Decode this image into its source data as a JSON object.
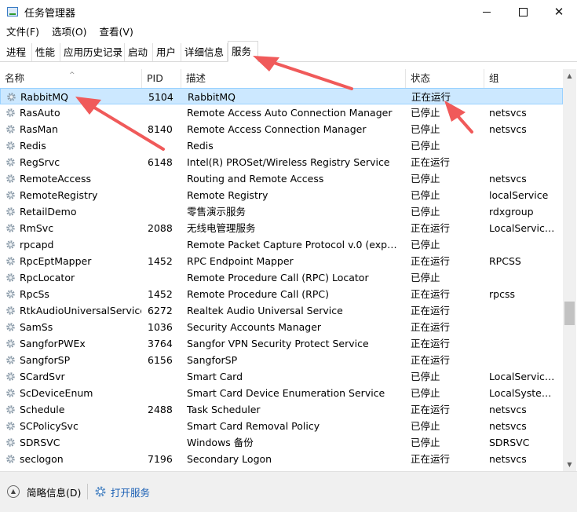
{
  "window": {
    "title": "任务管理器",
    "icon": "task-manager-icon",
    "controls": {
      "minimize": "minimize-icon",
      "maximize": "maximize-icon",
      "close": "✕"
    }
  },
  "menu": {
    "items": [
      "文件(F)",
      "选项(O)",
      "查看(V)"
    ]
  },
  "tabs": [
    "进程",
    "性能",
    "应用历史记录",
    "启动",
    "用户",
    "详细信息",
    "服务"
  ],
  "active_tab": "服务",
  "table": {
    "columns": {
      "name": "名称",
      "pid": "PID",
      "desc": "描述",
      "status": "状态",
      "group": "组"
    },
    "sort_indicator": "^",
    "rows": [
      {
        "name": "RabbitMQ",
        "pid": "5104",
        "desc": "RabbitMQ",
        "status": "正在运行",
        "group": ""
      },
      {
        "name": "RasAuto",
        "pid": "",
        "desc": "Remote Access Auto Connection Manager",
        "status": "已停止",
        "group": "netsvcs"
      },
      {
        "name": "RasMan",
        "pid": "8140",
        "desc": "Remote Access Connection Manager",
        "status": "已停止",
        "group": "netsvcs"
      },
      {
        "name": "Redis",
        "pid": "",
        "desc": "Redis",
        "status": "已停止",
        "group": ""
      },
      {
        "name": "RegSrvc",
        "pid": "6148",
        "desc": "Intel(R) PROSet/Wireless Registry Service",
        "status": "正在运行",
        "group": ""
      },
      {
        "name": "RemoteAccess",
        "pid": "",
        "desc": "Routing and Remote Access",
        "status": "已停止",
        "group": "netsvcs"
      },
      {
        "name": "RemoteRegistry",
        "pid": "",
        "desc": "Remote Registry",
        "status": "已停止",
        "group": "localService"
      },
      {
        "name": "RetailDemo",
        "pid": "",
        "desc": "零售演示服务",
        "status": "已停止",
        "group": "rdxgroup"
      },
      {
        "name": "RmSvc",
        "pid": "2088",
        "desc": "无线电管理服务",
        "status": "正在运行",
        "group": "LocalService..."
      },
      {
        "name": "rpcapd",
        "pid": "",
        "desc": "Remote Packet Capture Protocol v.0 (experi...",
        "status": "已停止",
        "group": ""
      },
      {
        "name": "RpcEptMapper",
        "pid": "1452",
        "desc": "RPC Endpoint Mapper",
        "status": "正在运行",
        "group": "RPCSS"
      },
      {
        "name": "RpcLocator",
        "pid": "",
        "desc": "Remote Procedure Call (RPC) Locator",
        "status": "已停止",
        "group": ""
      },
      {
        "name": "RpcSs",
        "pid": "1452",
        "desc": "Remote Procedure Call (RPC)",
        "status": "正在运行",
        "group": "rpcss"
      },
      {
        "name": "RtkAudioUniversalService",
        "pid": "6272",
        "desc": "Realtek Audio Universal Service",
        "status": "正在运行",
        "group": ""
      },
      {
        "name": "SamSs",
        "pid": "1036",
        "desc": "Security Accounts Manager",
        "status": "正在运行",
        "group": ""
      },
      {
        "name": "SangforPWEx",
        "pid": "3764",
        "desc": "Sangfor VPN Security Protect Service",
        "status": "正在运行",
        "group": ""
      },
      {
        "name": "SangforSP",
        "pid": "6156",
        "desc": "SangforSP",
        "status": "正在运行",
        "group": ""
      },
      {
        "name": "SCardSvr",
        "pid": "",
        "desc": "Smart Card",
        "status": "已停止",
        "group": "LocalService..."
      },
      {
        "name": "ScDeviceEnum",
        "pid": "",
        "desc": "Smart Card Device Enumeration Service",
        "status": "已停止",
        "group": "LocalSystem..."
      },
      {
        "name": "Schedule",
        "pid": "2488",
        "desc": "Task Scheduler",
        "status": "正在运行",
        "group": "netsvcs"
      },
      {
        "name": "SCPolicySvc",
        "pid": "",
        "desc": "Smart Card Removal Policy",
        "status": "已停止",
        "group": "netsvcs"
      },
      {
        "name": "SDRSVC",
        "pid": "",
        "desc": "Windows 备份",
        "status": "已停止",
        "group": "SDRSVC"
      },
      {
        "name": "seclogon",
        "pid": "7196",
        "desc": "Secondary Logon",
        "status": "正在运行",
        "group": "netsvcs"
      }
    ],
    "selected_index": 0
  },
  "footer": {
    "fewer_details": "简略信息(D)",
    "open_services": "打开服务"
  },
  "colors": {
    "selection_bg": "#cce8ff",
    "selection_border": "#99d1ff",
    "annotation_arrow": "#f05a5a",
    "link": "#1a5fb4",
    "gear": "#8a9aa8"
  }
}
